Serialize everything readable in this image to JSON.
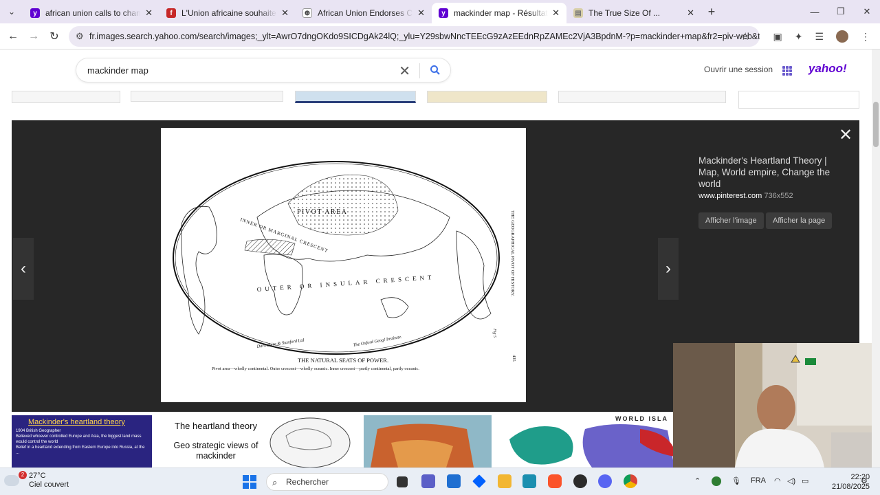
{
  "browser": {
    "tabs": [
      {
        "title": "african union calls to change th",
        "color": "#6001d2",
        "letter": "y"
      },
      {
        "title": "L'Union africaine souhaite une",
        "color": "#c62828",
        "letter": "f"
      },
      {
        "title": "African Union Endorses Call to",
        "color": "#333333",
        "letter": "⊕"
      },
      {
        "title": "mackinder map - Résultats Yah",
        "color": "#6001d2",
        "letter": "y"
      },
      {
        "title": "The True Size Of ...",
        "color": "#cfc4a0",
        "letter": "▤"
      }
    ],
    "url": "fr.images.search.yahoo.com/search/images;_ylt=AwrO7dngOKdo9SICDgAk24lQ;_ylu=Y29sbwNncTEEcG9zAzEEdnRpZAMEc2VjA3BpdnM-?p=mackinder+map&fr2=piv-web&type=E..."
  },
  "yahoo": {
    "query": "mackinder map",
    "signin": "Ouvrir une session",
    "logo": "yahoo!"
  },
  "viewer": {
    "title": "Mackinder's Heartland Theory | Map, World empire, Change the world",
    "source": "www.pinterest.com",
    "size": "736x552",
    "view_image": "Afficher l'image",
    "view_page": "Afficher la page"
  },
  "map": {
    "pivot": "PIVOT AREA",
    "inner_crescent": "INNER OR MARGINAL CRESCENT",
    "outer": "OUTER OR INSULAR CRESCENT",
    "heading": "THE NATURAL SEATS OF POWER.",
    "caption": "Pivot area—wholly continental.   Outer crescent—wholly oceanic.   Inner crescent—partly continental, partly oceanic.",
    "side": "THE GEOGRAPHICAL PIVOT OF HISTORY.",
    "page": "435",
    "fig": "Fig 5",
    "credit_left": "Darbishire & Stanford Ltd",
    "credit_right": "The Oxford Geog! Institute."
  },
  "bottom": {
    "b1_title": "Mackinder's heartland theory",
    "b1_lines": [
      "1904 British Geographer",
      "Believed whoever controlled Europe and Asia, the biggest land mass would control the world",
      "Belief in a heartland extending from Eastern Europe into Russia, at the ..."
    ],
    "b2_title": "The heartland theory",
    "b2_sub": "Geo strategic views of mackinder",
    "b4_label": "WORLD ISLA"
  },
  "taskbar": {
    "temp": "27°C",
    "weather": "Ciel couvert",
    "badge": "2",
    "search": "Rechercher",
    "lang": "FRA",
    "time": "22:20",
    "date": "21/08/2025"
  }
}
